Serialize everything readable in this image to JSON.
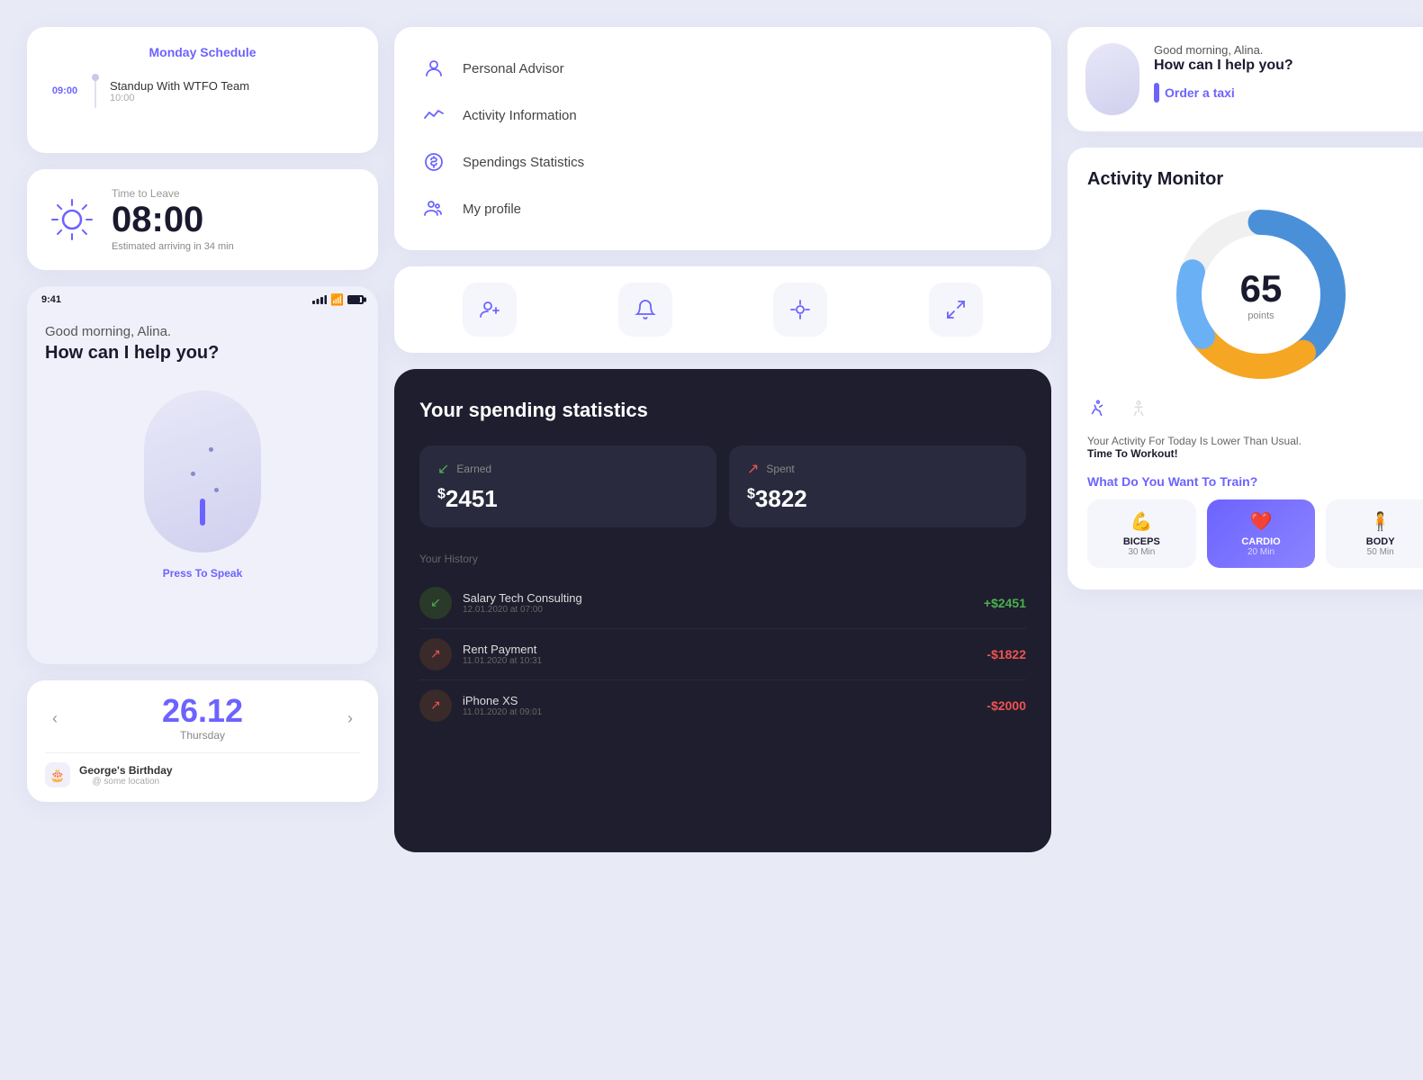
{
  "colors": {
    "accent": "#6c63ff",
    "dark_bg": "#1e1e2e",
    "light_bg": "#e8eaf6",
    "card_bg": "#ffffff"
  },
  "col1": {
    "monday": {
      "title": "Monday Schedule",
      "items": [
        {
          "time_top": "09:00",
          "label": "Standup With WTFO Team",
          "time_bottom": "10:00"
        }
      ]
    },
    "time_leave": {
      "sub": "Time to Leave",
      "time": "08:00",
      "estimated": "Estimated arriving in 34 min"
    },
    "phone": {
      "status_time": "9:41",
      "greeting": "Good morning, Alina.",
      "question": "How can I help you?",
      "press_label": "Press To Speak"
    },
    "date_card": {
      "date": "26.12",
      "day": "Thursday",
      "nav_prev": "‹",
      "nav_next": "›",
      "event_title": "George's Birthday",
      "event_sub": "@ some location"
    }
  },
  "col2": {
    "menu": {
      "items": [
        {
          "icon": "👤",
          "label": "Personal Advisor"
        },
        {
          "icon": "📈",
          "label": "Activity Information"
        },
        {
          "icon": "🕐",
          "label": "Spendings Statistics"
        },
        {
          "icon": "👥",
          "label": "My profile"
        }
      ]
    },
    "icons_row": [
      {
        "icon": "👤",
        "name": "add-user-icon"
      },
      {
        "icon": "🔔",
        "name": "bell-icon"
      },
      {
        "icon": "💡",
        "name": "ai-icon"
      },
      {
        "icon": "⊹",
        "name": "expand-icon"
      }
    ],
    "spending": {
      "title": "Your spending statistics",
      "earned_label": "Earned",
      "earned_amount": "2451",
      "spent_label": "Spent",
      "spent_amount": "3822",
      "history_title": "Your History",
      "history": [
        {
          "name": "Salary Tech Consulting",
          "date": "12.01.2020 at 07:00",
          "amount": "+$2451",
          "type": "pos"
        },
        {
          "name": "Rent Payment",
          "date": "11.01.2020 at 10:31",
          "amount": "-$1822",
          "type": "neg"
        },
        {
          "name": "iPhone XS",
          "date": "11.01.2020 at 09:01",
          "amount": "-$2000",
          "type": "neg"
        }
      ]
    }
  },
  "col3": {
    "assistant": {
      "greeting": "Good morning, Alina.",
      "question": "How can I help you?",
      "cta": "Order a taxi"
    },
    "activity": {
      "title": "Activity Monitor",
      "points": "65",
      "points_label": "points",
      "desc": "Your Activity For Today Is Lower Than Usual.",
      "desc_bold": "Time To Workout!",
      "train_title": "What Do You Want To Train?",
      "options": [
        {
          "icon": "💪",
          "name": "BICEPS",
          "duration": "30 Min",
          "active": false
        },
        {
          "icon": "❤️",
          "name": "CARDIO",
          "duration": "20 Min",
          "active": true
        },
        {
          "icon": "🧍",
          "name": "BODY",
          "duration": "50 Min",
          "active": false
        }
      ]
    }
  }
}
